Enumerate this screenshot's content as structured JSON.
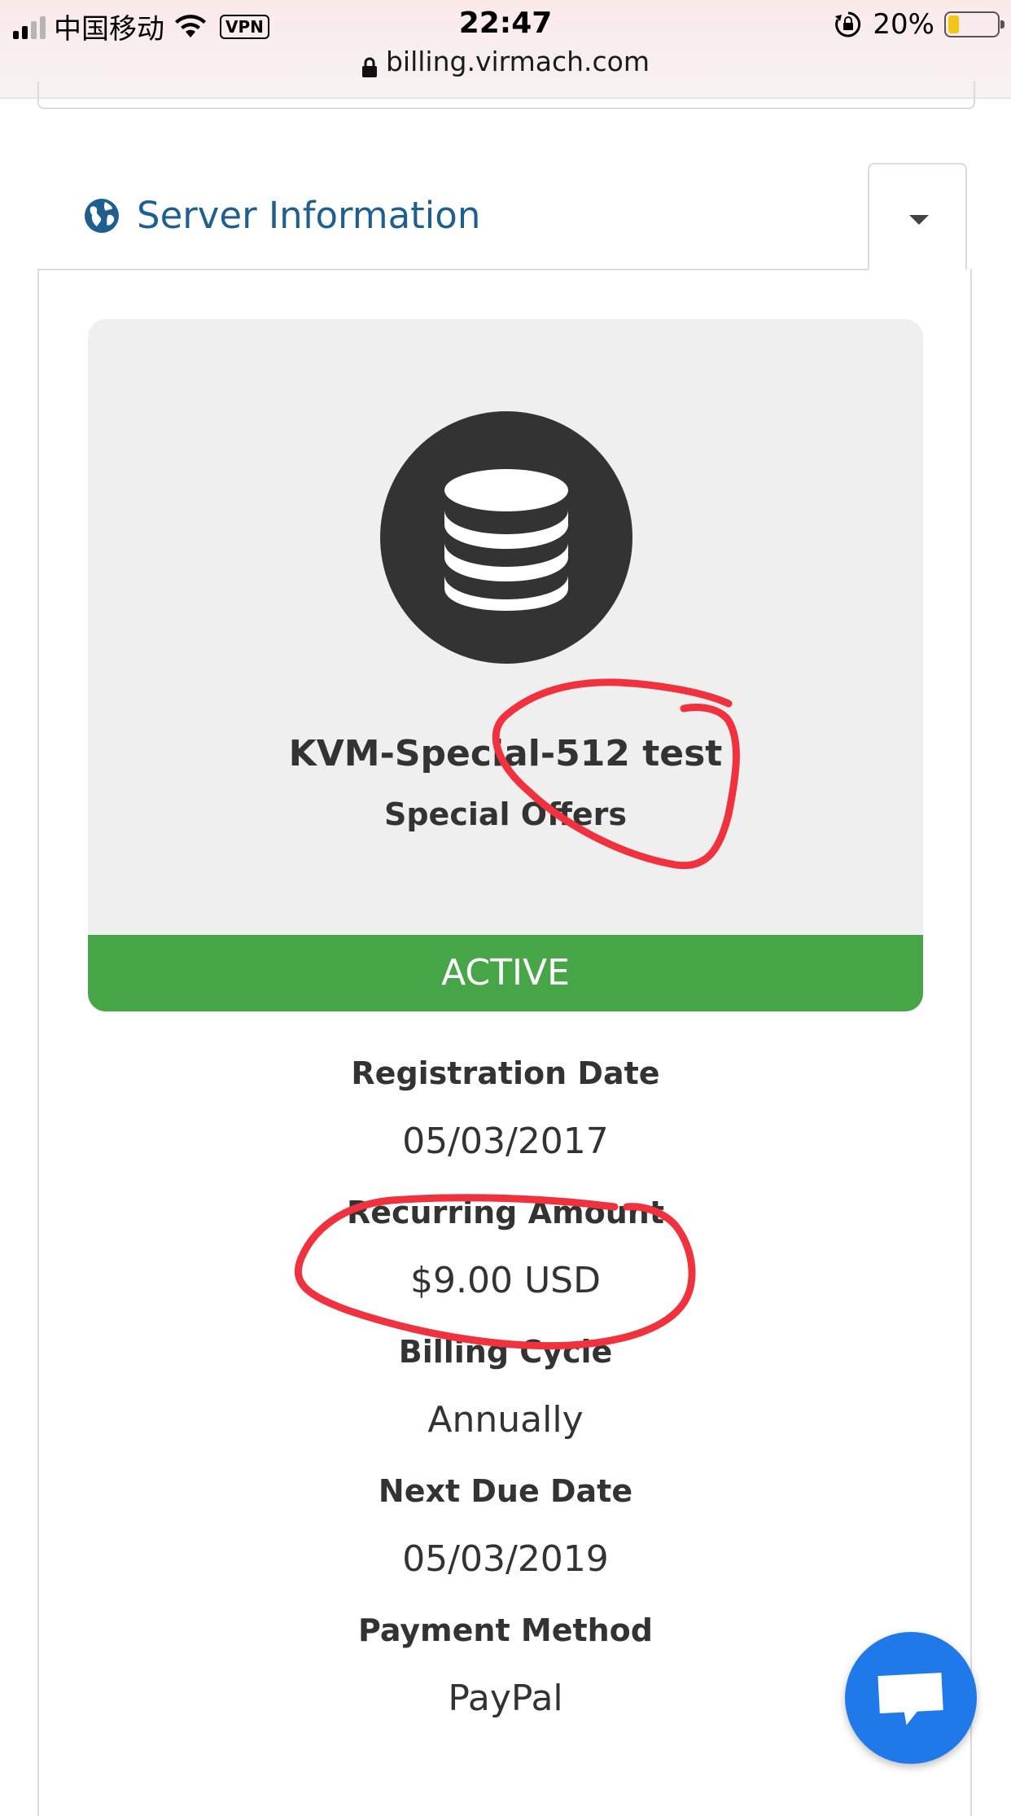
{
  "status_bar": {
    "carrier": "中国移动",
    "vpn": "VPN",
    "time": "22:47",
    "battery_percent": "20%",
    "battery_level": 0.2
  },
  "url_bar": {
    "url": "billing.virmach.com"
  },
  "section": {
    "title": "Server Information",
    "icon": "globe-icon"
  },
  "product": {
    "icon": "database-icon",
    "name": "KVM-Special-512 test",
    "group": "Special Offers",
    "status": "ACTIVE",
    "status_color": "#46a546"
  },
  "details": [
    {
      "label": "Registration Date",
      "value": "05/03/2017"
    },
    {
      "label": "Recurring Amount",
      "value": "$9.00 USD"
    },
    {
      "label": "Billing Cycle",
      "value": "Annually"
    },
    {
      "label": "Next Due Date",
      "value": "05/03/2019"
    },
    {
      "label": "Payment Method",
      "value": "PayPal"
    }
  ],
  "chat": {
    "icon": "chat-icon",
    "color": "#1f79e8"
  },
  "annotation_color": "#f0323f"
}
